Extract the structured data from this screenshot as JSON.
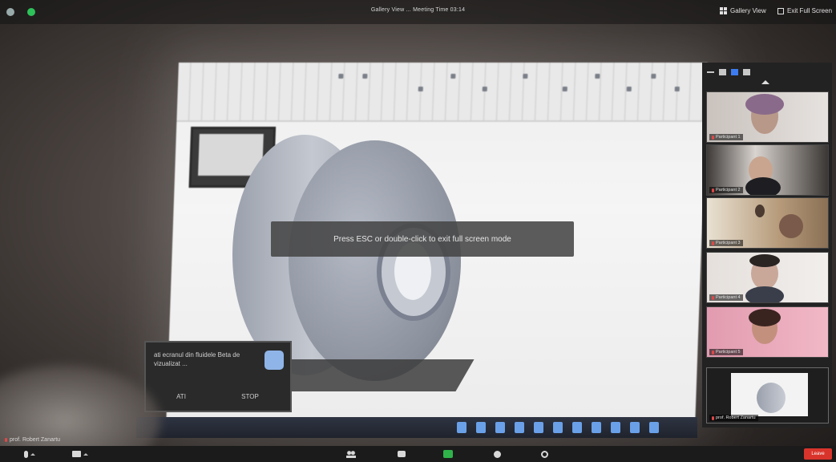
{
  "window": {
    "title": "Gallery View ... Meeting Time 03:14",
    "gallery_view_label": "Gallery View",
    "exit_full_screen_label": "Exit Full Screen"
  },
  "toast": {
    "message": "Press ESC or double-click to exit full screen mode"
  },
  "shared_screen": {
    "dialog_message": "ati ecranul din fluidele Beta de vizualizat ...",
    "dialog_btn_1": "ATI",
    "dialog_btn_2": "STOP"
  },
  "participants": [
    {
      "name": "Participant 1"
    },
    {
      "name": "Participant 2"
    },
    {
      "name": "Participant 3"
    },
    {
      "name": "Participant 4"
    },
    {
      "name": "Participant 5"
    },
    {
      "name": "prof. Robert Zanartu"
    }
  ],
  "active_speaker": "prof. Robert Zanartu",
  "toolbar": {
    "leave_label": "Leave"
  },
  "colors": {
    "accent": "#3d7cf0",
    "share_green": "#2fb24a",
    "leave_red": "#d9342b",
    "status_green": "#2ec25a"
  }
}
